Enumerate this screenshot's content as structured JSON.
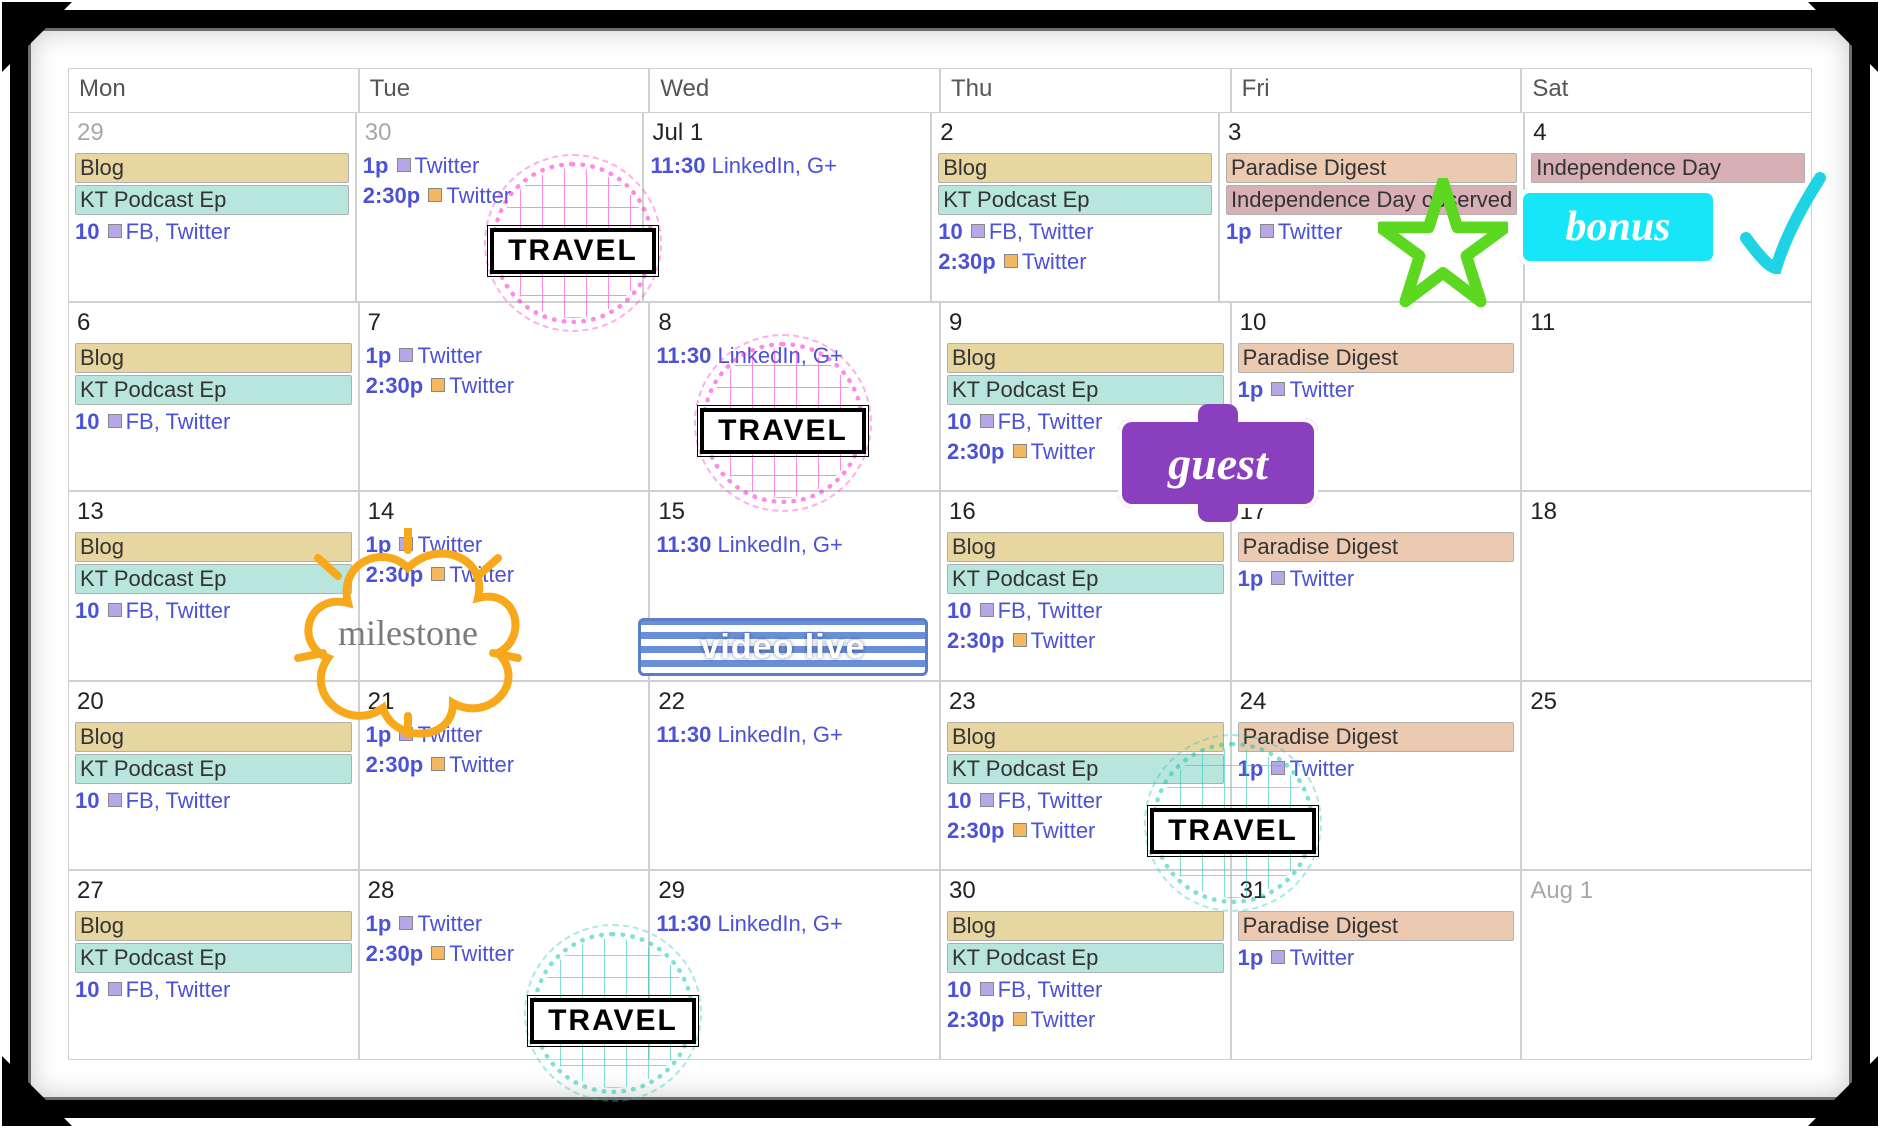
{
  "dow": [
    "Mon",
    "Tue",
    "Wed",
    "Thu",
    "Fri",
    "Sat"
  ],
  "weeks": [
    [
      {
        "date": "29",
        "other": true,
        "events": [
          {
            "kind": "bar",
            "cls": "ev-blog",
            "text": "Blog"
          },
          {
            "kind": "bar",
            "cls": "ev-podcast",
            "text": "KT Podcast Ep"
          },
          {
            "kind": "timed",
            "time": "10",
            "sq": "purple",
            "text": "FB, Twitter"
          }
        ]
      },
      {
        "date": "30",
        "other": true,
        "events": [
          {
            "kind": "timed",
            "time": "1p",
            "sq": "purple",
            "text": "Twitter"
          },
          {
            "kind": "timed",
            "time": "2:30p",
            "sq": "orange",
            "text": "Twitter"
          }
        ]
      },
      {
        "date": "Jul 1",
        "events": [
          {
            "kind": "timed",
            "time": "11:30",
            "sq": "",
            "text": "LinkedIn, G+"
          }
        ]
      },
      {
        "date": "2",
        "events": [
          {
            "kind": "bar",
            "cls": "ev-blog",
            "text": "Blog"
          },
          {
            "kind": "bar",
            "cls": "ev-podcast",
            "text": "KT Podcast Ep"
          },
          {
            "kind": "timed",
            "time": "10",
            "sq": "purple",
            "text": "FB, Twitter"
          },
          {
            "kind": "timed",
            "time": "2:30p",
            "sq": "orange",
            "text": "Twitter"
          }
        ]
      },
      {
        "date": "3",
        "events": [
          {
            "kind": "bar",
            "cls": "ev-digest",
            "text": "Paradise Digest"
          },
          {
            "kind": "bar",
            "cls": "ev-holiday",
            "text": "Independence Day observed"
          },
          {
            "kind": "timed",
            "time": "1p",
            "sq": "purple",
            "text": "Twitter"
          }
        ]
      },
      {
        "date": "4",
        "events": [
          {
            "kind": "bar",
            "cls": "ev-holiday",
            "text": "Independence Day"
          }
        ]
      }
    ],
    [
      {
        "date": "6",
        "events": [
          {
            "kind": "bar",
            "cls": "ev-blog",
            "text": "Blog"
          },
          {
            "kind": "bar",
            "cls": "ev-podcast",
            "text": "KT Podcast Ep"
          },
          {
            "kind": "timed",
            "time": "10",
            "sq": "purple",
            "text": "FB, Twitter"
          }
        ]
      },
      {
        "date": "7",
        "events": [
          {
            "kind": "timed",
            "time": "1p",
            "sq": "purple",
            "text": "Twitter"
          },
          {
            "kind": "timed",
            "time": "2:30p",
            "sq": "orange",
            "text": "Twitter"
          }
        ]
      },
      {
        "date": "8",
        "events": [
          {
            "kind": "timed",
            "time": "11:30",
            "sq": "",
            "text": "LinkedIn, G+"
          }
        ]
      },
      {
        "date": "9",
        "events": [
          {
            "kind": "bar",
            "cls": "ev-blog",
            "text": "Blog"
          },
          {
            "kind": "bar",
            "cls": "ev-podcast",
            "text": "KT Podcast Ep"
          },
          {
            "kind": "timed",
            "time": "10",
            "sq": "purple",
            "text": "FB, Twitter"
          },
          {
            "kind": "timed",
            "time": "2:30p",
            "sq": "orange",
            "text": "Twitter"
          }
        ]
      },
      {
        "date": "10",
        "events": [
          {
            "kind": "bar",
            "cls": "ev-digest",
            "text": "Paradise Digest"
          },
          {
            "kind": "timed",
            "time": "1p",
            "sq": "purple",
            "text": "Twitter"
          }
        ]
      },
      {
        "date": "11",
        "events": []
      }
    ],
    [
      {
        "date": "13",
        "events": [
          {
            "kind": "bar",
            "cls": "ev-blog",
            "text": "Blog"
          },
          {
            "kind": "bar",
            "cls": "ev-podcast",
            "text": "KT Podcast Ep"
          },
          {
            "kind": "timed",
            "time": "10",
            "sq": "purple",
            "text": "FB, Twitter"
          }
        ]
      },
      {
        "date": "14",
        "events": [
          {
            "kind": "timed",
            "time": "1p",
            "sq": "purple",
            "text": "Twitter"
          },
          {
            "kind": "timed",
            "time": "2:30p",
            "sq": "orange",
            "text": "Twitter"
          }
        ]
      },
      {
        "date": "15",
        "events": [
          {
            "kind": "timed",
            "time": "11:30",
            "sq": "",
            "text": "LinkedIn, G+"
          }
        ]
      },
      {
        "date": "16",
        "events": [
          {
            "kind": "bar",
            "cls": "ev-blog",
            "text": "Blog"
          },
          {
            "kind": "bar",
            "cls": "ev-podcast",
            "text": "KT Podcast Ep"
          },
          {
            "kind": "timed",
            "time": "10",
            "sq": "purple",
            "text": "FB, Twitter"
          },
          {
            "kind": "timed",
            "time": "2:30p",
            "sq": "orange",
            "text": "Twitter"
          }
        ]
      },
      {
        "date": "17",
        "events": [
          {
            "kind": "bar",
            "cls": "ev-digest",
            "text": "Paradise Digest"
          },
          {
            "kind": "timed",
            "time": "1p",
            "sq": "purple",
            "text": "Twitter"
          }
        ]
      },
      {
        "date": "18",
        "events": []
      }
    ],
    [
      {
        "date": "20",
        "events": [
          {
            "kind": "bar",
            "cls": "ev-blog",
            "text": "Blog"
          },
          {
            "kind": "bar",
            "cls": "ev-podcast",
            "text": "KT Podcast Ep"
          },
          {
            "kind": "timed",
            "time": "10",
            "sq": "purple",
            "text": "FB, Twitter"
          }
        ]
      },
      {
        "date": "21",
        "events": [
          {
            "kind": "timed",
            "time": "1p",
            "sq": "purple",
            "text": "Twitter"
          },
          {
            "kind": "timed",
            "time": "2:30p",
            "sq": "orange",
            "text": "Twitter"
          }
        ]
      },
      {
        "date": "22",
        "events": [
          {
            "kind": "timed",
            "time": "11:30",
            "sq": "",
            "text": "LinkedIn, G+"
          }
        ]
      },
      {
        "date": "23",
        "events": [
          {
            "kind": "bar",
            "cls": "ev-blog",
            "text": "Blog"
          },
          {
            "kind": "bar",
            "cls": "ev-podcast",
            "text": "KT Podcast Ep"
          },
          {
            "kind": "timed",
            "time": "10",
            "sq": "purple",
            "text": "FB, Twitter"
          },
          {
            "kind": "timed",
            "time": "2:30p",
            "sq": "orange",
            "text": "Twitter"
          }
        ]
      },
      {
        "date": "24",
        "events": [
          {
            "kind": "bar",
            "cls": "ev-digest",
            "text": "Paradise Digest"
          },
          {
            "kind": "timed",
            "time": "1p",
            "sq": "purple",
            "text": "Twitter"
          }
        ]
      },
      {
        "date": "25",
        "events": []
      }
    ],
    [
      {
        "date": "27",
        "events": [
          {
            "kind": "bar",
            "cls": "ev-blog",
            "text": "Blog"
          },
          {
            "kind": "bar",
            "cls": "ev-podcast",
            "text": "KT Podcast Ep"
          },
          {
            "kind": "timed",
            "time": "10",
            "sq": "purple",
            "text": "FB, Twitter"
          }
        ]
      },
      {
        "date": "28",
        "events": [
          {
            "kind": "timed",
            "time": "1p",
            "sq": "purple",
            "text": "Twitter"
          },
          {
            "kind": "timed",
            "time": "2:30p",
            "sq": "orange",
            "text": "Twitter"
          }
        ]
      },
      {
        "date": "29",
        "events": [
          {
            "kind": "timed",
            "time": "11:30",
            "sq": "",
            "text": "LinkedIn, G+"
          }
        ]
      },
      {
        "date": "30",
        "events": [
          {
            "kind": "bar",
            "cls": "ev-blog",
            "text": "Blog"
          },
          {
            "kind": "bar",
            "cls": "ev-podcast",
            "text": "KT Podcast Ep"
          },
          {
            "kind": "timed",
            "time": "10",
            "sq": "purple",
            "text": "FB, Twitter"
          },
          {
            "kind": "timed",
            "time": "2:30p",
            "sq": "orange",
            "text": "Twitter"
          }
        ]
      },
      {
        "date": "31",
        "events": [
          {
            "kind": "bar",
            "cls": "ev-digest",
            "text": "Paradise Digest"
          },
          {
            "kind": "timed",
            "time": "1p",
            "sq": "purple",
            "text": "Twitter"
          }
        ]
      },
      {
        "date": "Aug 1",
        "other": true,
        "events": []
      }
    ]
  ],
  "stickers": {
    "travel_label": "TRAVEL",
    "milestone_label": "milestone",
    "video_label": "video live",
    "guest_label": "guest",
    "bonus_label": "bonus"
  }
}
